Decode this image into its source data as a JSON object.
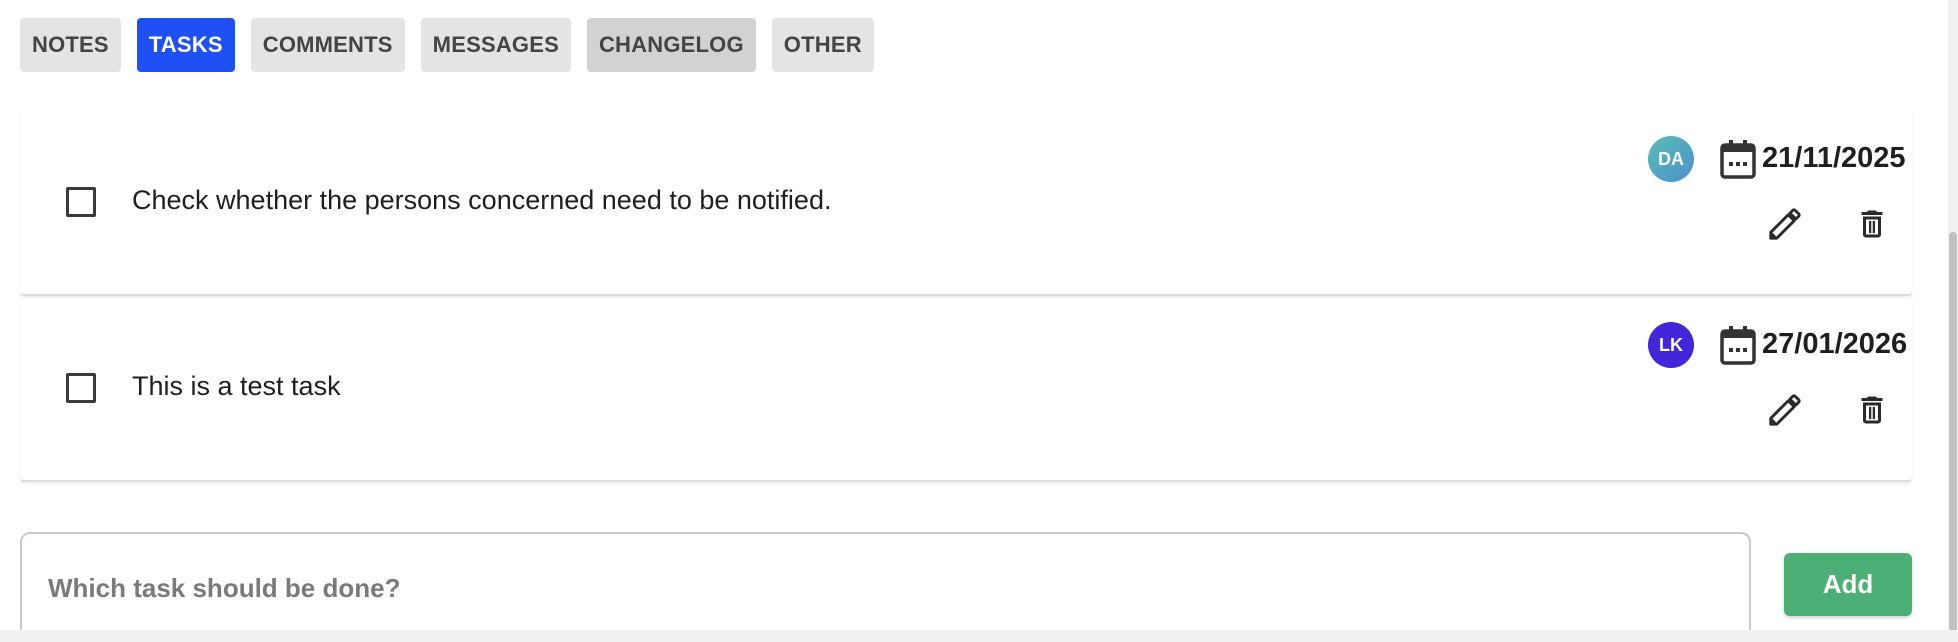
{
  "tabs": [
    {
      "label": "NOTES"
    },
    {
      "label": "TASKS"
    },
    {
      "label": "COMMENTS"
    },
    {
      "label": "MESSAGES"
    },
    {
      "label": "CHANGELOG"
    },
    {
      "label": "OTHER"
    }
  ],
  "active_tab": "TASKS",
  "tasks": [
    {
      "text": "Check whether the persons concerned need to be notified.",
      "assignee_initials": "DA",
      "due_date": "21/11/2025",
      "done": false
    },
    {
      "text": "This is a test task",
      "assignee_initials": "LK",
      "due_date": "27/01/2026",
      "done": false
    }
  ],
  "new_task": {
    "placeholder": "Which task should be done?",
    "value": "",
    "add_label": "Add"
  },
  "icons": {
    "due": "calendar-icon",
    "edit": "pencil-icon",
    "delete": "trash-icon"
  },
  "colors": {
    "active_tab": "#1e50f5",
    "tab_background": "#e4e4e4",
    "add_button": "#4caf75",
    "avatar_da_start": "#5bbdb5",
    "avatar_da_end": "#4a8fcf",
    "avatar_lk": "#4326d9"
  }
}
